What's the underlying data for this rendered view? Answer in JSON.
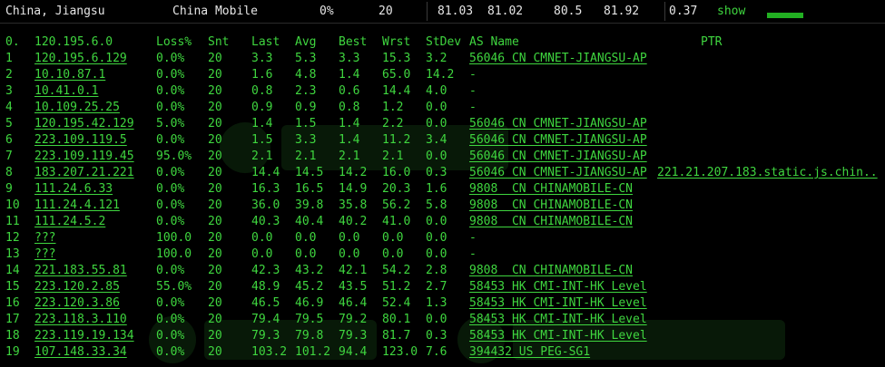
{
  "top": {
    "location": "China, Jiangsu",
    "isp": "China Mobile",
    "loss": "0%",
    "sent": "20",
    "v1": "81.03",
    "v2": "81.02",
    "v3": "80.5",
    "v4": "81.92",
    "v5": "0.37",
    "show": "show"
  },
  "colors": {
    "text": "#3fd63f",
    "light": "#e6e6e6",
    "background": "#000000",
    "bar": "#22b022"
  },
  "headers": [
    "0.",
    "120.195.6.0",
    "Loss%",
    "Snt",
    "Last",
    "Avg",
    "Best",
    "Wrst",
    "StDev",
    "AS Name",
    "PTR"
  ],
  "rows": [
    [
      "1",
      "120.195.6.129",
      "0.0%",
      "20",
      "3.3",
      "5.3",
      "3.3",
      "15.3",
      "3.2",
      "56046 CN CMNET-JIANGSU-AP",
      ""
    ],
    [
      "2",
      "10.10.87.1",
      "0.0%",
      "20",
      "1.6",
      "4.8",
      "1.4",
      "65.0",
      "14.2",
      "-",
      ""
    ],
    [
      "3",
      "10.41.0.1",
      "0.0%",
      "20",
      "0.8",
      "2.3",
      "0.6",
      "14.4",
      "4.0",
      "-",
      ""
    ],
    [
      "4",
      "10.109.25.25",
      "0.0%",
      "20",
      "0.9",
      "0.9",
      "0.8",
      "1.2",
      "0.0",
      "-",
      ""
    ],
    [
      "5",
      "120.195.42.129",
      "5.0%",
      "20",
      "1.4",
      "1.5",
      "1.4",
      "2.2",
      "0.0",
      "56046 CN CMNET-JIANGSU-AP",
      ""
    ],
    [
      "6",
      "223.109.119.5",
      "0.0%",
      "20",
      "1.5",
      "3.3",
      "1.4",
      "11.2",
      "3.4",
      "56046 CN CMNET-JIANGSU-AP",
      ""
    ],
    [
      "7",
      "223.109.119.45",
      "95.0%",
      "20",
      "2.1",
      "2.1",
      "2.1",
      "2.1",
      "0.0",
      "56046 CN CMNET-JIANGSU-AP",
      ""
    ],
    [
      "8",
      "183.207.21.221",
      "0.0%",
      "20",
      "14.4",
      "14.5",
      "14.2",
      "16.0",
      "0.3",
      "56046 CN CMNET-JIANGSU-AP",
      "221.21.207.183.static.js.chin.."
    ],
    [
      "9",
      "111.24.6.33",
      "0.0%",
      "20",
      "16.3",
      "16.5",
      "14.9",
      "20.3",
      "1.6",
      "9808  CN CHINAMOBILE-CN",
      ""
    ],
    [
      "10",
      "111.24.4.121",
      "0.0%",
      "20",
      "36.0",
      "39.8",
      "35.8",
      "56.2",
      "5.8",
      "9808  CN CHINAMOBILE-CN",
      ""
    ],
    [
      "11",
      "111.24.5.2",
      "0.0%",
      "20",
      "40.3",
      "40.4",
      "40.2",
      "41.0",
      "0.0",
      "9808  CN CHINAMOBILE-CN",
      ""
    ],
    [
      "12",
      "???",
      "100.0",
      "20",
      "0.0",
      "0.0",
      "0.0",
      "0.0",
      "0.0",
      "-",
      ""
    ],
    [
      "13",
      "???",
      "100.0",
      "20",
      "0.0",
      "0.0",
      "0.0",
      "0.0",
      "0.0",
      "-",
      ""
    ],
    [
      "14",
      "221.183.55.81",
      "0.0%",
      "20",
      "42.3",
      "43.2",
      "42.1",
      "54.2",
      "2.8",
      "9808  CN CHINAMOBILE-CN",
      ""
    ],
    [
      "15",
      "223.120.2.85",
      "55.0%",
      "20",
      "48.9",
      "45.2",
      "43.5",
      "51.2",
      "2.7",
      "58453 HK CMI-INT-HK Level",
      ""
    ],
    [
      "16",
      "223.120.3.86",
      "0.0%",
      "20",
      "46.5",
      "46.9",
      "46.4",
      "52.4",
      "1.3",
      "58453 HK CMI-INT-HK Level",
      ""
    ],
    [
      "17",
      "223.118.3.110",
      "0.0%",
      "20",
      "79.4",
      "79.5",
      "79.2",
      "80.1",
      "0.0",
      "58453 HK CMI-INT-HK Level",
      ""
    ],
    [
      "18",
      "223.119.19.134",
      "0.0%",
      "20",
      "79.3",
      "79.8",
      "79.3",
      "81.7",
      "0.3",
      "58453 HK CMI-INT-HK Level",
      ""
    ],
    [
      "19",
      "107.148.33.34",
      "0.0%",
      "20",
      "103.2",
      "101.2",
      "94.4",
      "123.0",
      "7.6",
      "394432 US PEG-SG1",
      ""
    ]
  ]
}
